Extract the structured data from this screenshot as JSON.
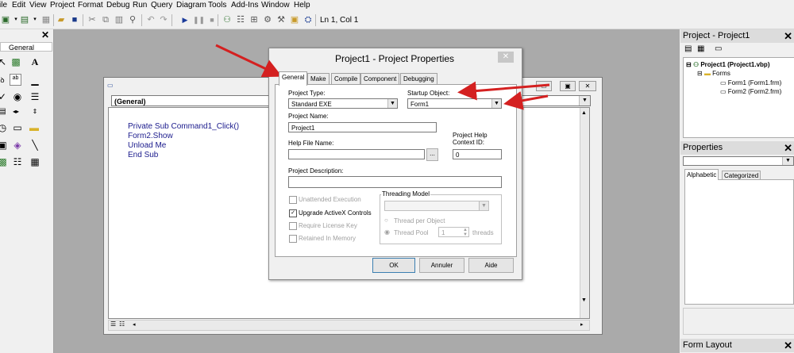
{
  "menu": [
    "ile",
    "Edit",
    "View",
    "Project",
    "Format",
    "Debug",
    "Run",
    "Query",
    "Diagram",
    "Tools",
    "Add-Ins",
    "Window",
    "Help"
  ],
  "toolbar": {
    "position": "Ln 1, Col 1"
  },
  "toolbox": {
    "title": "General",
    "close": "✕"
  },
  "code_window": {
    "object_combo": "(General)",
    "code_lines": [
      "Private Sub Command1_Click()",
      "Form2.Show",
      "Unload Me",
      "End Sub"
    ]
  },
  "project_explorer": {
    "title": "Project - Project1",
    "close": "✕",
    "tree": {
      "root": "Project1 (Project1.vbp)",
      "folder": "Forms",
      "items": [
        "Form1 (Form1.frm)",
        "Form2 (Form2.frm)"
      ]
    }
  },
  "properties": {
    "title": "Properties",
    "close": "✕",
    "tabs": [
      "Alphabetic",
      "Categorized"
    ]
  },
  "form_layout": {
    "title": "Form Layout",
    "close": "✕"
  },
  "dialog": {
    "title": "Project1 - Project Properties",
    "close": "✕",
    "tabs": [
      "General",
      "Make",
      "Compile",
      "Component",
      "Debugging"
    ],
    "project_type_label": "Project Type:",
    "project_type_value": "Standard EXE",
    "startup_object_label": "Startup Object:",
    "startup_object_value": "Form1",
    "project_name_label": "Project Name:",
    "project_name_value": "Project1",
    "help_file_label": "Help File Name:",
    "help_file_value": "",
    "browse_label": "...",
    "help_context_label_1": "Project Help",
    "help_context_label_2": "Context ID:",
    "help_context_value": "0",
    "description_label": "Project Description:",
    "description_value": "",
    "unattended_label": "Unattended Execution",
    "upgrade_activex_label": "Upgrade ActiveX Controls",
    "require_license_label": "Require License Key",
    "retained_label": "Retained In Memory",
    "threading_group_label": "Threading Model",
    "thread_per_object_label": "Thread per Object",
    "thread_pool_label": "Thread Pool",
    "thread_pool_value": "1",
    "threads_label": "threads",
    "ok_label": "OK",
    "cancel_label": "Annuler",
    "help_label": "Aide"
  },
  "colors": {
    "annotation_arrow": "#d42020",
    "code_text": "#1a1a8c",
    "mdi_background": "#aaaaaa"
  }
}
